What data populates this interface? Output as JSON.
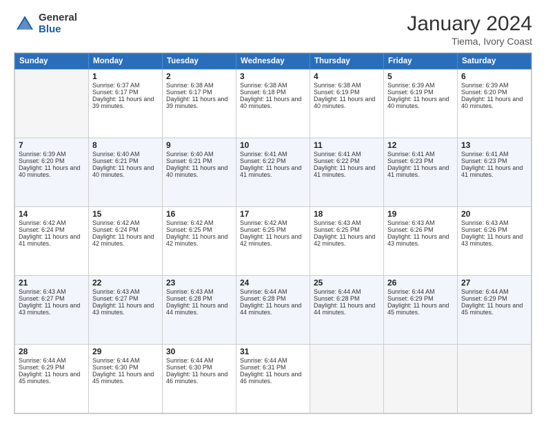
{
  "header": {
    "logo_general": "General",
    "logo_blue": "Blue",
    "month_title": "January 2024",
    "location": "Tiema, Ivory Coast"
  },
  "days_of_week": [
    "Sunday",
    "Monday",
    "Tuesday",
    "Wednesday",
    "Thursday",
    "Friday",
    "Saturday"
  ],
  "weeks": [
    [
      {
        "date": "",
        "sunrise": "",
        "sunset": "",
        "daylight": ""
      },
      {
        "date": "1",
        "sunrise": "Sunrise: 6:37 AM",
        "sunset": "Sunset: 6:17 PM",
        "daylight": "Daylight: 11 hours and 39 minutes."
      },
      {
        "date": "2",
        "sunrise": "Sunrise: 6:38 AM",
        "sunset": "Sunset: 6:17 PM",
        "daylight": "Daylight: 11 hours and 39 minutes."
      },
      {
        "date": "3",
        "sunrise": "Sunrise: 6:38 AM",
        "sunset": "Sunset: 6:18 PM",
        "daylight": "Daylight: 11 hours and 40 minutes."
      },
      {
        "date": "4",
        "sunrise": "Sunrise: 6:38 AM",
        "sunset": "Sunset: 6:19 PM",
        "daylight": "Daylight: 11 hours and 40 minutes."
      },
      {
        "date": "5",
        "sunrise": "Sunrise: 6:39 AM",
        "sunset": "Sunset: 6:19 PM",
        "daylight": "Daylight: 11 hours and 40 minutes."
      },
      {
        "date": "6",
        "sunrise": "Sunrise: 6:39 AM",
        "sunset": "Sunset: 6:20 PM",
        "daylight": "Daylight: 11 hours and 40 minutes."
      }
    ],
    [
      {
        "date": "7",
        "sunrise": "Sunrise: 6:39 AM",
        "sunset": "Sunset: 6:20 PM",
        "daylight": "Daylight: 11 hours and 40 minutes."
      },
      {
        "date": "8",
        "sunrise": "Sunrise: 6:40 AM",
        "sunset": "Sunset: 6:21 PM",
        "daylight": "Daylight: 11 hours and 40 minutes."
      },
      {
        "date": "9",
        "sunrise": "Sunrise: 6:40 AM",
        "sunset": "Sunset: 6:21 PM",
        "daylight": "Daylight: 11 hours and 40 minutes."
      },
      {
        "date": "10",
        "sunrise": "Sunrise: 6:41 AM",
        "sunset": "Sunset: 6:22 PM",
        "daylight": "Daylight: 11 hours and 41 minutes."
      },
      {
        "date": "11",
        "sunrise": "Sunrise: 6:41 AM",
        "sunset": "Sunset: 6:22 PM",
        "daylight": "Daylight: 11 hours and 41 minutes."
      },
      {
        "date": "12",
        "sunrise": "Sunrise: 6:41 AM",
        "sunset": "Sunset: 6:23 PM",
        "daylight": "Daylight: 11 hours and 41 minutes."
      },
      {
        "date": "13",
        "sunrise": "Sunrise: 6:41 AM",
        "sunset": "Sunset: 6:23 PM",
        "daylight": "Daylight: 11 hours and 41 minutes."
      }
    ],
    [
      {
        "date": "14",
        "sunrise": "Sunrise: 6:42 AM",
        "sunset": "Sunset: 6:24 PM",
        "daylight": "Daylight: 11 hours and 41 minutes."
      },
      {
        "date": "15",
        "sunrise": "Sunrise: 6:42 AM",
        "sunset": "Sunset: 6:24 PM",
        "daylight": "Daylight: 11 hours and 42 minutes."
      },
      {
        "date": "16",
        "sunrise": "Sunrise: 6:42 AM",
        "sunset": "Sunset: 6:25 PM",
        "daylight": "Daylight: 11 hours and 42 minutes."
      },
      {
        "date": "17",
        "sunrise": "Sunrise: 6:42 AM",
        "sunset": "Sunset: 6:25 PM",
        "daylight": "Daylight: 11 hours and 42 minutes."
      },
      {
        "date": "18",
        "sunrise": "Sunrise: 6:43 AM",
        "sunset": "Sunset: 6:25 PM",
        "daylight": "Daylight: 11 hours and 42 minutes."
      },
      {
        "date": "19",
        "sunrise": "Sunrise: 6:43 AM",
        "sunset": "Sunset: 6:26 PM",
        "daylight": "Daylight: 11 hours and 43 minutes."
      },
      {
        "date": "20",
        "sunrise": "Sunrise: 6:43 AM",
        "sunset": "Sunset: 6:26 PM",
        "daylight": "Daylight: 11 hours and 43 minutes."
      }
    ],
    [
      {
        "date": "21",
        "sunrise": "Sunrise: 6:43 AM",
        "sunset": "Sunset: 6:27 PM",
        "daylight": "Daylight: 11 hours and 43 minutes."
      },
      {
        "date": "22",
        "sunrise": "Sunrise: 6:43 AM",
        "sunset": "Sunset: 6:27 PM",
        "daylight": "Daylight: 11 hours and 43 minutes."
      },
      {
        "date": "23",
        "sunrise": "Sunrise: 6:43 AM",
        "sunset": "Sunset: 6:28 PM",
        "daylight": "Daylight: 11 hours and 44 minutes."
      },
      {
        "date": "24",
        "sunrise": "Sunrise: 6:44 AM",
        "sunset": "Sunset: 6:28 PM",
        "daylight": "Daylight: 11 hours and 44 minutes."
      },
      {
        "date": "25",
        "sunrise": "Sunrise: 6:44 AM",
        "sunset": "Sunset: 6:28 PM",
        "daylight": "Daylight: 11 hours and 44 minutes."
      },
      {
        "date": "26",
        "sunrise": "Sunrise: 6:44 AM",
        "sunset": "Sunset: 6:29 PM",
        "daylight": "Daylight: 11 hours and 45 minutes."
      },
      {
        "date": "27",
        "sunrise": "Sunrise: 6:44 AM",
        "sunset": "Sunset: 6:29 PM",
        "daylight": "Daylight: 11 hours and 45 minutes."
      }
    ],
    [
      {
        "date": "28",
        "sunrise": "Sunrise: 6:44 AM",
        "sunset": "Sunset: 6:29 PM",
        "daylight": "Daylight: 11 hours and 45 minutes."
      },
      {
        "date": "29",
        "sunrise": "Sunrise: 6:44 AM",
        "sunset": "Sunset: 6:30 PM",
        "daylight": "Daylight: 11 hours and 45 minutes."
      },
      {
        "date": "30",
        "sunrise": "Sunrise: 6:44 AM",
        "sunset": "Sunset: 6:30 PM",
        "daylight": "Daylight: 11 hours and 46 minutes."
      },
      {
        "date": "31",
        "sunrise": "Sunrise: 6:44 AM",
        "sunset": "Sunset: 6:31 PM",
        "daylight": "Daylight: 11 hours and 46 minutes."
      },
      {
        "date": "",
        "sunrise": "",
        "sunset": "",
        "daylight": ""
      },
      {
        "date": "",
        "sunrise": "",
        "sunset": "",
        "daylight": ""
      },
      {
        "date": "",
        "sunrise": "",
        "sunset": "",
        "daylight": ""
      }
    ]
  ]
}
